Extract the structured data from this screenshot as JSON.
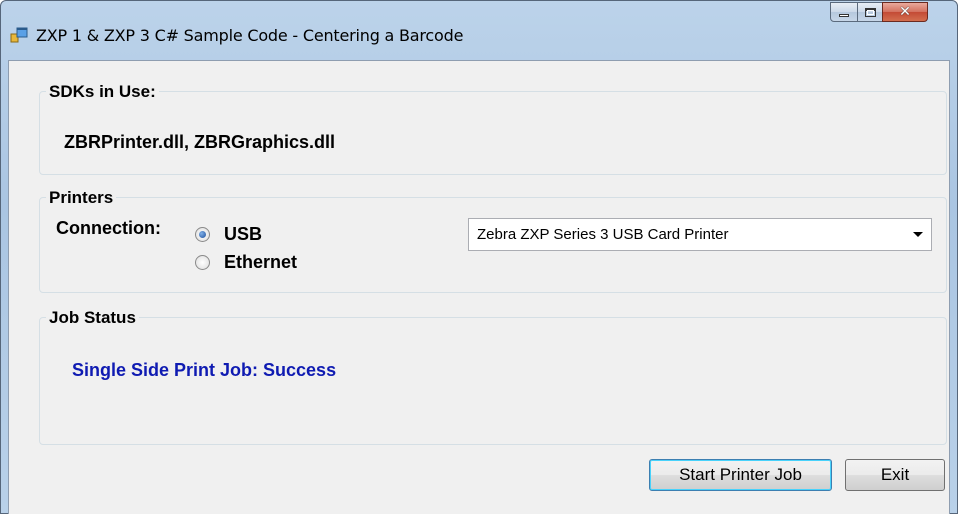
{
  "window": {
    "title": "ZXP 1 & ZXP 3 C# Sample Code - Centering a Barcode",
    "icon": "app-window-icon",
    "controls": {
      "minimize": "minimize-icon",
      "maximize": "maximize-icon",
      "close": "close-icon"
    }
  },
  "sdk_group": {
    "title": "SDKs in Use:",
    "value": "ZBRPrinter.dll, ZBRGraphics.dll"
  },
  "printers_group": {
    "title": "Printers",
    "connection_label": "Connection:",
    "options": [
      {
        "label": "USB",
        "checked": true
      },
      {
        "label": "Ethernet",
        "checked": false
      }
    ],
    "selected_printer": "Zebra ZXP Series 3 USB Card Printer"
  },
  "status_group": {
    "title": "Job Status",
    "value": "Single Side Print Job: Success",
    "value_color": "#0f1bb2"
  },
  "buttons": {
    "start": "Start Printer Job",
    "exit": "Exit"
  }
}
